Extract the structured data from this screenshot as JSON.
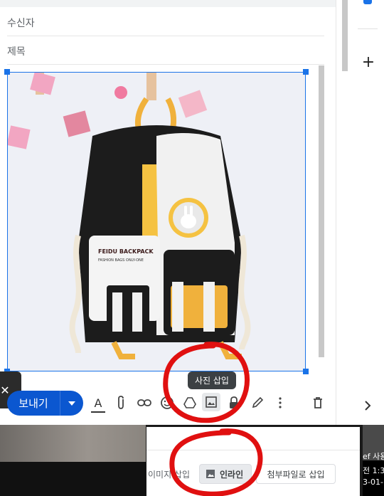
{
  "compose": {
    "to_placeholder": "수신자",
    "subject_placeholder": "제목",
    "send_label": "보내기"
  },
  "image": {
    "brand_text": "FEIDU BACKPACK",
    "sub_text": "FASHION BAGS ONLY-ONE"
  },
  "tooltip": {
    "text": "사진 삽입"
  },
  "toolbar": {
    "icons": [
      "text-format-icon",
      "paperclip-icon",
      "link-icon",
      "emoji-icon",
      "drive-icon",
      "image-icon",
      "lock-icon",
      "pen-icon",
      "more-icon",
      "trash-icon"
    ]
  },
  "insert_panel": {
    "label": "이미지 삽입",
    "inline_label": "인라인",
    "attach_label": "첨부파일로 삽입"
  },
  "right_panel": {
    "add_icon": "plus-icon",
    "chevron": "chevron-right-icon"
  },
  "thumb_text": {
    "line1": "ef 사용",
    "line2": "전 1:3",
    "line3": "3-01-"
  },
  "colors": {
    "accent": "#0b57d0",
    "selection": "#1a73e8",
    "annotation": "#e01010"
  }
}
